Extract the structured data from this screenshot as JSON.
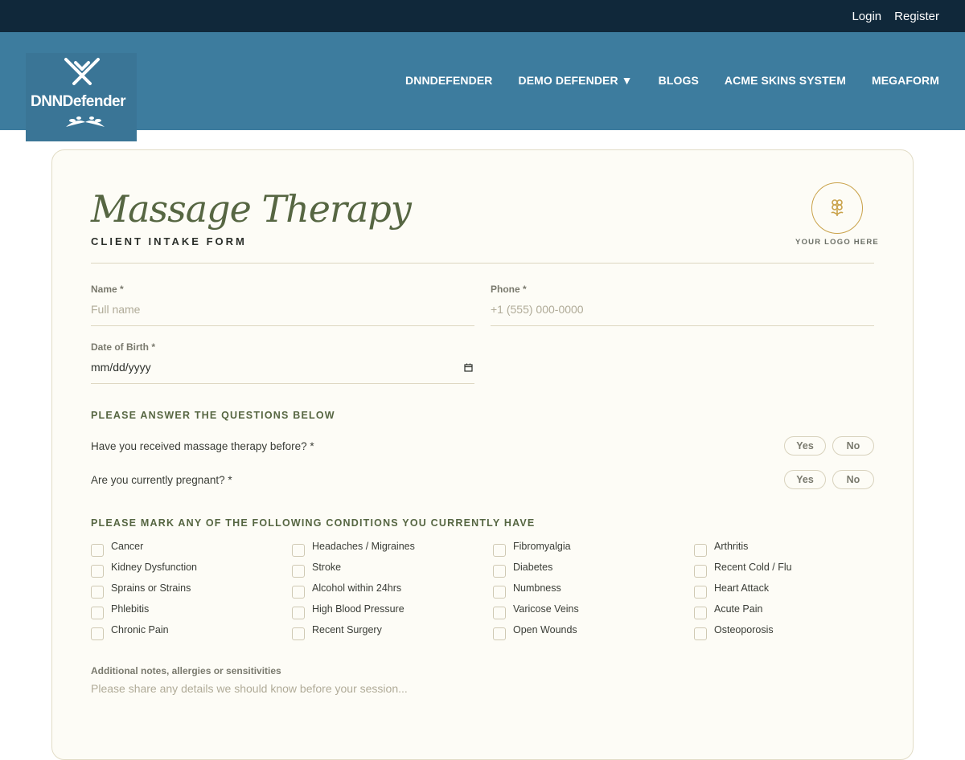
{
  "topbar": {
    "login": "Login",
    "register": "Register"
  },
  "brand": {
    "logo_text": "DNNDefender"
  },
  "nav": {
    "items": [
      "DNNDEFENDER",
      "DEMO DEFENDER ▼",
      "BLOGS",
      "ACME SKINS SYSTEM",
      "MEGAFORM"
    ]
  },
  "form": {
    "title": "Massage Therapy",
    "subtitle": "CLIENT INTAKE FORM",
    "logo_caption": "YOUR LOGO HERE",
    "name_label": "Name *",
    "name_placeholder": "Full name",
    "phone_label": "Phone *",
    "phone_placeholder": "+1 (555) 000-0000",
    "dob_label": "Date of Birth *",
    "dob_value": "mm/dd/yyyy",
    "questions_heading": "PLEASE ANSWER THE QUESTIONS BELOW",
    "questions": [
      {
        "text": "Have you received massage therapy before? *",
        "yes": "Yes",
        "no": "No"
      },
      {
        "text": "Are you currently pregnant? *",
        "yes": "Yes",
        "no": "No"
      }
    ],
    "conditions_heading": "PLEASE MARK ANY OF THE FOLLOWING CONDITIONS YOU CURRENTLY HAVE",
    "conditions": [
      "Cancer",
      "Headaches / Migraines",
      "Fibromyalgia",
      "Arthritis",
      "Kidney Dysfunction",
      "Stroke",
      "Diabetes",
      "Recent Cold / Flu",
      "Sprains or Strains",
      "Alcohol within 24hrs",
      "Numbness",
      "Heart Attack",
      "Phlebitis",
      "High Blood Pressure",
      "Varicose Veins",
      "Acute Pain",
      "Chronic Pain",
      "Recent Surgery",
      "Open Wounds",
      "Osteoporosis"
    ],
    "notes_label": "Additional notes, allergies or sensitivities",
    "notes_placeholder": "Please share any details we should know before your session..."
  },
  "colors": {
    "topbar": "#10283a",
    "navbar": "#3d7c9e",
    "accent_olive": "#566642",
    "gold": "#c9a24a",
    "card_bg": "#fdfcf6"
  },
  "icons": {
    "logo_badge": "flower-icon",
    "date_picker": "calendar-icon"
  }
}
